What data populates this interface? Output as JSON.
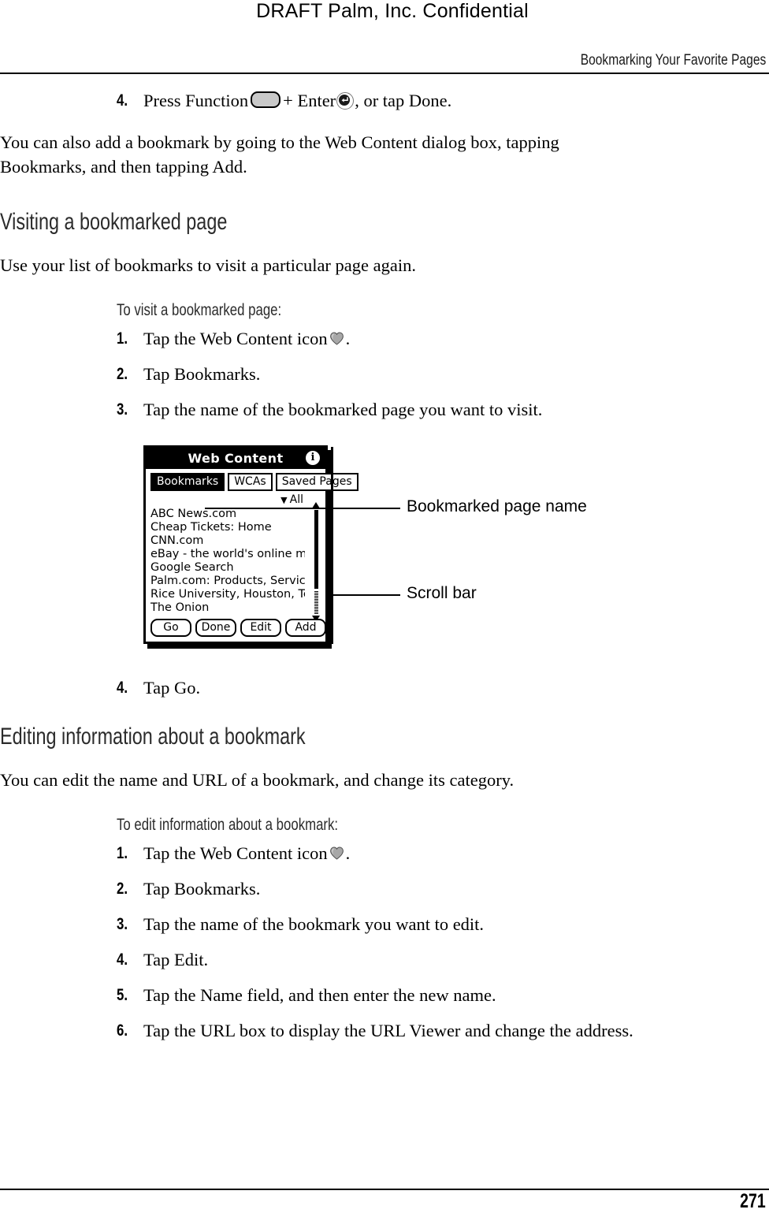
{
  "header": {
    "draft_stamp": "DRAFT   Palm, Inc. Confidential",
    "running_head": "Bookmarking Your Favorite Pages"
  },
  "footer": {
    "page_number": "271"
  },
  "content": {
    "step4_top": {
      "number": "4.",
      "text_before_fn": "Press Function",
      "text_between": "+ Enter",
      "text_after": ", or tap Done."
    },
    "intro_paragraph": "You can also add a bookmark by going to the Web Content dialog box, tapping Bookmarks, and then tapping Add.",
    "section1": {
      "heading": "Visiting a bookmarked page",
      "paragraph": "Use your list of bookmarks to visit a particular page again.",
      "procedure_heading": "To visit a bookmarked page:",
      "steps": [
        {
          "number": "1.",
          "text_before_icon": "Tap the Web Content icon",
          "text_after_icon": "."
        },
        {
          "number": "2.",
          "text": "Tap Bookmarks."
        },
        {
          "number": "3.",
          "text": "Tap the name of the bookmarked page you want to visit."
        }
      ],
      "step_after_figure": {
        "number": "4.",
        "text": "Tap Go."
      }
    },
    "section2": {
      "heading": "Editing information about a bookmark",
      "paragraph": "You can edit the name and URL of a bookmark, and change its category.",
      "procedure_heading": "To edit information about a bookmark:",
      "steps": [
        {
          "number": "1.",
          "text_before_icon": "Tap the Web Content icon",
          "text_after_icon": "."
        },
        {
          "number": "2.",
          "text": "Tap Bookmarks."
        },
        {
          "number": "3.",
          "text": "Tap the name of the bookmark you want to edit."
        },
        {
          "number": "4.",
          "text": "Tap Edit."
        },
        {
          "number": "5.",
          "text": "Tap the Name field, and then enter the new name."
        },
        {
          "number": "6.",
          "text": "Tap the URL box to display the URL Viewer and change the address."
        }
      ]
    }
  },
  "figure": {
    "device_screen": {
      "title": "Web Content",
      "info_icon": "i",
      "tabs": [
        {
          "label": "Bookmarks",
          "selected": true
        },
        {
          "label": "WCAs",
          "selected": false
        },
        {
          "label": "Saved Pages",
          "selected": false
        }
      ],
      "category_filter": "All",
      "category_caret": "▼",
      "bookmarks": [
        "ABC News.com",
        "Cheap Tickets: Home",
        "CNN.com",
        "eBay - the world's online marketp",
        "Google Search",
        "Palm.com: Products, Services & Co",
        "Rice University, Houston, Texas",
        "The Onion"
      ],
      "buttons": [
        "Go",
        "Done",
        "Edit",
        "Add"
      ]
    },
    "callouts": [
      {
        "label": "Bookmarked page name"
      },
      {
        "label": "Scroll bar"
      }
    ]
  },
  "colors": {
    "ink": "#000000",
    "heading_gray": "#2b2b2b",
    "key_fill": "#c9c9c9",
    "icon_gray": "#9e9e9e"
  }
}
